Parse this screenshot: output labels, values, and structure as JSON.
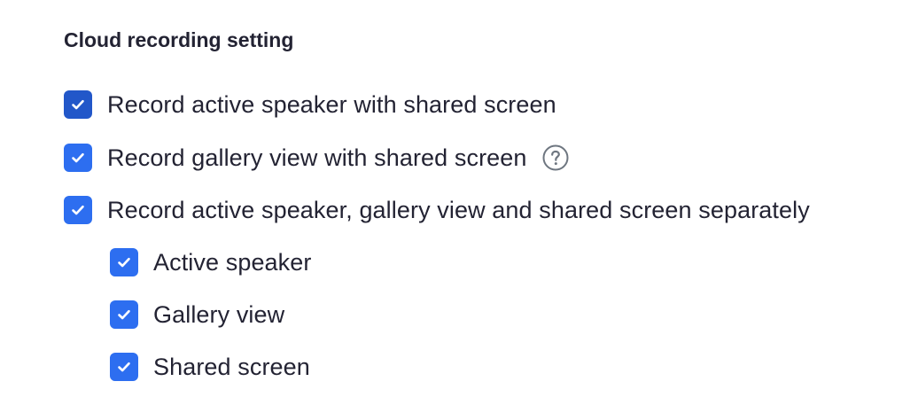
{
  "section": {
    "title": "Cloud recording setting"
  },
  "options": [
    {
      "label": "Record active speaker with shared screen",
      "checked": true
    },
    {
      "label": "Record gallery view with shared screen",
      "checked": true,
      "help_icon": "question-circle-icon"
    },
    {
      "label": "Record active speaker, gallery view and shared screen separately",
      "checked": true
    },
    {
      "label": "Active speaker",
      "checked": true
    },
    {
      "label": "Gallery view",
      "checked": true
    },
    {
      "label": "Shared screen",
      "checked": true
    }
  ],
  "colors": {
    "checkbox_fill": "#2d6ef0",
    "checkbox_fill_focused": "#2257c9",
    "text": "#232333",
    "help_icon": "#6e7680"
  }
}
